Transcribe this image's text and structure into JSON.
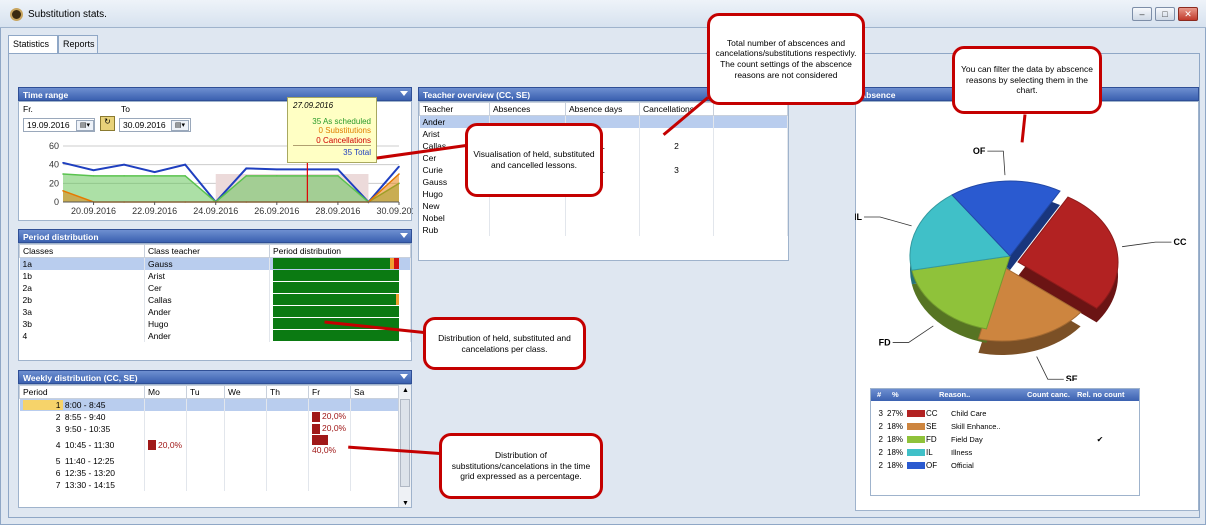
{
  "window": {
    "title": "Substitution stats.",
    "min": "–",
    "max": "□",
    "close": "✕"
  },
  "tabs": [
    {
      "label": "Statistics"
    },
    {
      "label": "Reports"
    }
  ],
  "time_range": {
    "header": "Time range",
    "from_label": "Fr.",
    "to_label": "To",
    "from_value": "19.09.2016",
    "to_value": "30.09.2016",
    "tooltip": {
      "date": "27.09.2016",
      "scheduled": "35 As scheduled",
      "substitutions": "0 Substitutions",
      "cancellations": "0 Cancellations",
      "total": "35 Total"
    },
    "chart_data": {
      "type": "area",
      "x": [
        "19.09.2016",
        "20.09.2016",
        "21.09.2016",
        "22.09.2016",
        "23.09.2016",
        "24.09.2016",
        "25.09.2016",
        "26.09.2016",
        "27.09.2016",
        "28.09.2016",
        "29.09.2016",
        "30.09.2016"
      ],
      "y_ticks": [
        "0",
        "20",
        "40",
        "60"
      ],
      "x_tick_labels": [
        "20.09.2016",
        "22.09.2016",
        "24.09.2016",
        "26.09.2016",
        "28.09.2016",
        "30.09.2016"
      ],
      "ylim": [
        0,
        60
      ],
      "series": [
        {
          "values": [
            42,
            34,
            40,
            32,
            40,
            0,
            36,
            35,
            35,
            35,
            0,
            38
          ],
          "color": "#1f3fbf"
        },
        {
          "values": [
            30,
            28,
            28,
            28,
            28,
            0,
            28,
            28,
            28,
            28,
            0,
            20
          ],
          "color": "#59c24e"
        },
        {
          "values": [
            12,
            0,
            0,
            0,
            0,
            0,
            0,
            0,
            0,
            0,
            0,
            30
          ],
          "color": "#e67a00"
        }
      ]
    }
  },
  "period_distribution": {
    "header": "Period distribution",
    "columns": [
      "Classes",
      "Class teacher",
      "Period distribution"
    ],
    "rows": [
      {
        "cls": "1a",
        "teacher": "Gauss",
        "held": 0.93,
        "sub": 0.03,
        "canc": 0.04
      },
      {
        "cls": "1b",
        "teacher": "Arist",
        "held": 1.0,
        "sub": 0,
        "canc": 0
      },
      {
        "cls": "2a",
        "teacher": "Cer",
        "held": 1.0,
        "sub": 0,
        "canc": 0
      },
      {
        "cls": "2b",
        "teacher": "Callas",
        "held": 0.98,
        "sub": 0.02,
        "canc": 0
      },
      {
        "cls": "3a",
        "teacher": "Ander",
        "held": 1.0,
        "sub": 0,
        "canc": 0
      },
      {
        "cls": "3b",
        "teacher": "Hugo",
        "held": 1.0,
        "sub": 0,
        "canc": 0
      },
      {
        "cls": "4",
        "teacher": "Ander",
        "held": 1.0,
        "sub": 0,
        "canc": 0
      }
    ]
  },
  "weekly": {
    "header": "Weekly distribution (CC, SE)",
    "columns": [
      "Period",
      "Mo",
      "Tu",
      "We",
      "Th",
      "Fr",
      "Sa"
    ],
    "rows": [
      {
        "n": "1",
        "time": "8:00 - 8:45",
        "mo": "",
        "fr": ""
      },
      {
        "n": "2",
        "time": "8:55 - 9:40",
        "mo": "",
        "fr": "20,0%"
      },
      {
        "n": "3",
        "time": "9:50 - 10:35",
        "mo": "",
        "fr": "20,0%"
      },
      {
        "n": "4",
        "time": "10:45 - 11:30",
        "mo": "20,0%",
        "fr": "40,0%"
      },
      {
        "n": "5",
        "time": "11:40 - 12:25",
        "mo": "",
        "fr": ""
      },
      {
        "n": "6",
        "time": "12:35 - 13:20",
        "mo": "",
        "fr": ""
      },
      {
        "n": "7",
        "time": "13:30 - 14:15",
        "mo": "",
        "fr": ""
      }
    ]
  },
  "teacher_overview": {
    "header": "Teacher overview (CC, SE)",
    "columns": [
      "Teacher",
      "Absences",
      "Absence days",
      "Cancellations"
    ],
    "rows": [
      {
        "name": "Ander",
        "abs": "",
        "days": "",
        "canc": ""
      },
      {
        "name": "Arist",
        "abs": "",
        "days": "",
        "canc": ""
      },
      {
        "name": "Callas",
        "abs": "",
        "days": "1",
        "canc": "2"
      },
      {
        "name": "Cer",
        "abs": "",
        "days": "",
        "canc": ""
      },
      {
        "name": "Curie",
        "abs": "",
        "days": "1",
        "canc": "3"
      },
      {
        "name": "Gauss",
        "abs": "",
        "days": "",
        "canc": ""
      },
      {
        "name": "Hugo",
        "abs": "",
        "days": "",
        "canc": ""
      },
      {
        "name": "New",
        "abs": "",
        "days": "",
        "canc": ""
      },
      {
        "name": "Nobel",
        "abs": "",
        "days": "",
        "canc": ""
      },
      {
        "name": "Rub",
        "abs": "",
        "days": "",
        "canc": ""
      }
    ]
  },
  "absence": {
    "header": "Absence",
    "chart_data": {
      "type": "pie",
      "slices": [
        {
          "code": "CC",
          "label": "Child Care",
          "value": 27,
          "color": "#b22222"
        },
        {
          "code": "SE",
          "label": "Skill Enhance..",
          "value": 18,
          "color": "#cd853f"
        },
        {
          "code": "FD",
          "label": "Field Day",
          "value": 18,
          "color": "#8fc23a"
        },
        {
          "code": "IL",
          "label": "Illness",
          "value": 18,
          "color": "#40c0c8"
        },
        {
          "code": "OF",
          "label": "Official",
          "value": 18,
          "color": "#2a5ad0"
        }
      ]
    },
    "legend": {
      "columns": [
        "#",
        "%",
        "Reason..",
        "Count canc.",
        "Rel. no count"
      ],
      "rows": [
        {
          "n": "3",
          "pct": "27%",
          "code": "CC",
          "name": "Child Care",
          "count": "",
          "rel": "",
          "color": "#b22222"
        },
        {
          "n": "2",
          "pct": "18%",
          "code": "SE",
          "name": "Skill Enhance..",
          "count": "",
          "rel": "",
          "color": "#cd853f"
        },
        {
          "n": "2",
          "pct": "18%",
          "code": "FD",
          "name": "Field Day",
          "count": "",
          "rel": "✔",
          "color": "#8fc23a"
        },
        {
          "n": "2",
          "pct": "18%",
          "code": "IL",
          "name": "Illness",
          "count": "",
          "rel": "",
          "color": "#40c0c8"
        },
        {
          "n": "2",
          "pct": "18%",
          "code": "OF",
          "name": "Official",
          "count": "",
          "rel": "",
          "color": "#2a5ad0"
        }
      ]
    }
  },
  "callouts": {
    "total": "Total number of abscences and cancelations/substitutions respectivly. The count settings of the abscence reasons are not considered",
    "filter": "You can filter the data by abscence reasons by selecting them in the chart.",
    "visual": "Visualisation of held, substituted and cancelled lessons.",
    "dist": "Distribution of held, substituted and cancelations per class.",
    "grid": "Distribution of substitutions/cancelations in the time grid expressed as a percentage."
  }
}
